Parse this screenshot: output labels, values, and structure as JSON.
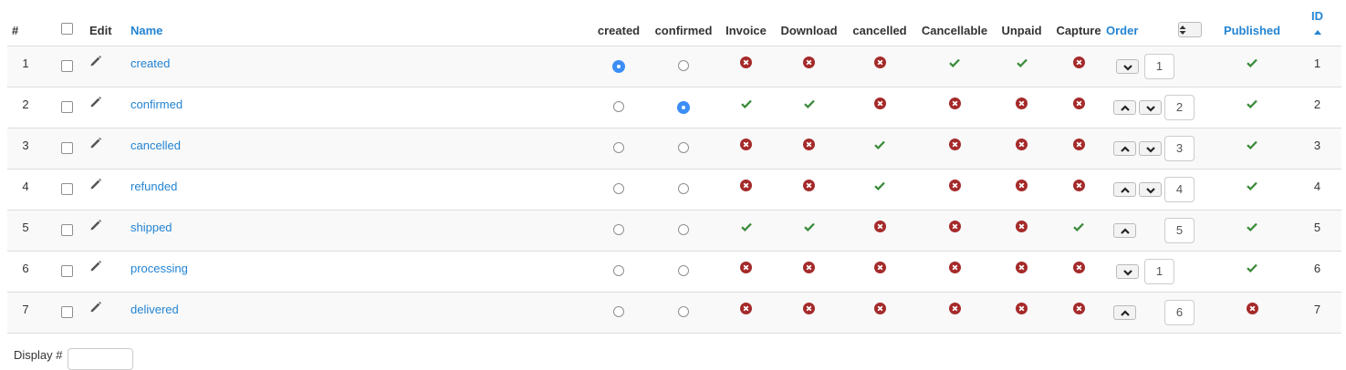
{
  "headers": {
    "num": "#",
    "edit": "Edit",
    "name": "Name",
    "created": "created",
    "confirmed": "confirmed",
    "invoice": "Invoice",
    "download": "Download",
    "cancelled": "cancelled",
    "cancellable": "Cancellable",
    "unpaid": "Unpaid",
    "capture": "Capture",
    "order": "Order",
    "published": "Published",
    "id": "ID"
  },
  "rows": [
    {
      "num": "1",
      "name": "created",
      "created": true,
      "confirmed": false,
      "invoice": false,
      "download": false,
      "cancelled": false,
      "cancellable": true,
      "unpaid": true,
      "capture": false,
      "up": false,
      "down": true,
      "order": "1",
      "published": true,
      "id": "1"
    },
    {
      "num": "2",
      "name": "confirmed",
      "created": false,
      "confirmed": true,
      "invoice": true,
      "download": true,
      "cancelled": false,
      "cancellable": false,
      "unpaid": false,
      "capture": false,
      "up": true,
      "down": true,
      "order": "2",
      "published": true,
      "id": "2"
    },
    {
      "num": "3",
      "name": "cancelled",
      "created": false,
      "confirmed": false,
      "invoice": false,
      "download": false,
      "cancelled": true,
      "cancellable": false,
      "unpaid": false,
      "capture": false,
      "up": true,
      "down": true,
      "order": "3",
      "published": true,
      "id": "3"
    },
    {
      "num": "4",
      "name": "refunded",
      "created": false,
      "confirmed": false,
      "invoice": false,
      "download": false,
      "cancelled": true,
      "cancellable": false,
      "unpaid": false,
      "capture": false,
      "up": true,
      "down": true,
      "order": "4",
      "published": true,
      "id": "4"
    },
    {
      "num": "5",
      "name": "shipped",
      "created": false,
      "confirmed": false,
      "invoice": true,
      "download": true,
      "cancelled": false,
      "cancellable": false,
      "unpaid": false,
      "capture": true,
      "up": true,
      "down": false,
      "order": "5",
      "published": true,
      "id": "5"
    },
    {
      "num": "6",
      "name": "processing",
      "created": false,
      "confirmed": false,
      "invoice": false,
      "download": false,
      "cancelled": false,
      "cancellable": false,
      "unpaid": false,
      "capture": false,
      "up": false,
      "down": true,
      "order": "1",
      "published": true,
      "id": "6"
    },
    {
      "num": "7",
      "name": "delivered",
      "created": false,
      "confirmed": false,
      "invoice": false,
      "download": false,
      "cancelled": false,
      "cancellable": false,
      "unpaid": false,
      "capture": false,
      "up": true,
      "down": false,
      "order": "6",
      "published": false,
      "id": "7"
    }
  ],
  "footer": {
    "display_label": "Display #"
  },
  "colors": {
    "link": "#2384d3",
    "check": "#3a8a3a",
    "cross": "#a52a2a",
    "radio_selected": "#3b8ef5"
  },
  "icons": {
    "edit": "pencil-icon",
    "yes": "checkmark-icon",
    "no": "cross-circle-icon",
    "move_up": "chevron-up-icon",
    "move_down": "chevron-down-icon",
    "sort": "sort-icon",
    "sort_direction": "caret-up-icon"
  }
}
